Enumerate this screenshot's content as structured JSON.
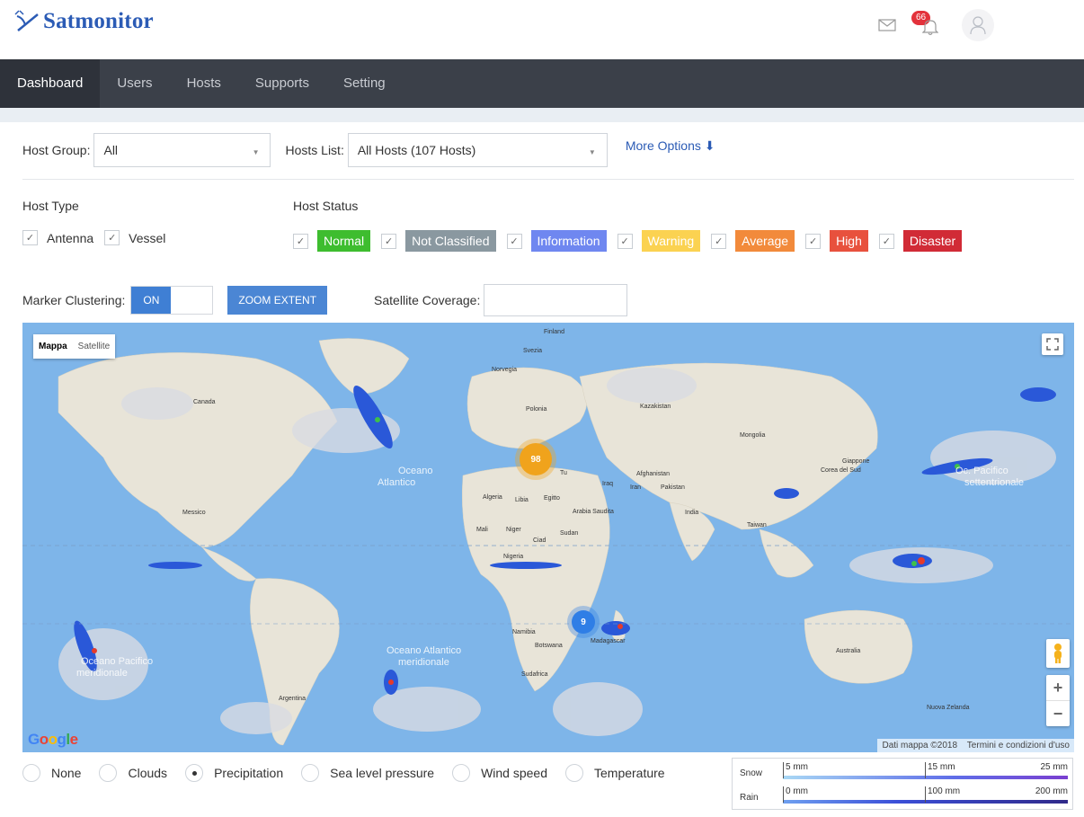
{
  "app": {
    "name": "Satmonitor"
  },
  "header": {
    "notification_count": "66"
  },
  "nav": {
    "items": [
      {
        "label": "Dashboard",
        "active": true
      },
      {
        "label": "Users"
      },
      {
        "label": "Hosts"
      },
      {
        "label": "Supports"
      },
      {
        "label": "Setting"
      }
    ]
  },
  "filters": {
    "host_group_label": "Host Group:",
    "host_group_value": "All",
    "hosts_list_label": "Hosts List:",
    "hosts_list_value": "All Hosts (107 Hosts)",
    "more_options": "More Options ⬇"
  },
  "host_type": {
    "title": "Host Type",
    "options": [
      {
        "label": "Antenna",
        "checked": true
      },
      {
        "label": "Vessel",
        "checked": true
      }
    ]
  },
  "host_status": {
    "title": "Host Status",
    "options": [
      {
        "label": "Normal",
        "color": "#3ebd2f",
        "checked": true
      },
      {
        "label": "Not Classified",
        "color": "#8a98a0",
        "checked": true
      },
      {
        "label": "Information",
        "color": "#6f87f0",
        "checked": true
      },
      {
        "label": "Warning",
        "color": "#fbd251",
        "checked": true
      },
      {
        "label": "Average",
        "color": "#f28a3b",
        "checked": true
      },
      {
        "label": "High",
        "color": "#e8513d",
        "checked": true
      },
      {
        "label": "Disaster",
        "color": "#d12b36",
        "checked": true
      }
    ]
  },
  "controls": {
    "marker_clustering_label": "Marker Clustering:",
    "toggle_on": "ON",
    "zoom_extent": "ZOOM EXTENT",
    "satellite_coverage_label": "Satellite Coverage:"
  },
  "map": {
    "type_map": "Mappa",
    "type_satellite": "Satellite",
    "attribution_data": "Dati mappa ©2018",
    "attribution_terms": "Termini e condizioni d'uso",
    "clusters": [
      {
        "count": "98",
        "color": "#f0a31c"
      },
      {
        "count": "9",
        "color": "#2f7ee6"
      }
    ],
    "labels": {
      "canada": "Canada",
      "messico": "Messico",
      "argentina": "Argentina",
      "finland": "Finland",
      "svezia": "Svezia",
      "norvegia": "Norvegia",
      "polonia": "Polonia",
      "kazakistan": "Kazakistan",
      "mongolia": "Mongolia",
      "algeria": "Algeria",
      "libia": "Libia",
      "egitto": "Egitto",
      "mali": "Mali",
      "niger": "Niger",
      "ciad": "Ciad",
      "sudan": "Sudan",
      "nigeria": "Nigeria",
      "arabia": "Arabia Saudita",
      "iraq": "Iraq",
      "iran": "Iran",
      "afghanistan": "Afghanistan",
      "pakistan": "Pakistan",
      "india": "India",
      "corea": "Corea del Sud",
      "giappone": "Giappone",
      "australia": "Australia",
      "nzelanda": "Nuova Zelanda",
      "namibia": "Namibia",
      "botswana": "Botswana",
      "sudafrica": "Sudafrica",
      "madagascar": "Madagascar",
      "pacifico": "Oceano Pacifico",
      "meridionale": "meridionale",
      "atlantico": "Atlantico",
      "oceano": "Oceano",
      "oc_pac": "Oc. Pacifico",
      "settentrionale": "settentrionale",
      "oceano_atl_s": "Oceano Atlantico",
      "meridionale2": "meridionale",
      "tu": "Tu",
      "taiwan": "Taiwan"
    }
  },
  "layers": {
    "options": [
      {
        "label": "None",
        "selected": false
      },
      {
        "label": "Clouds",
        "selected": false
      },
      {
        "label": "Precipitation",
        "selected": true
      },
      {
        "label": "Sea level pressure",
        "selected": false
      },
      {
        "label": "Wind speed",
        "selected": false
      },
      {
        "label": "Temperature",
        "selected": false
      }
    ]
  },
  "legend": {
    "snow": {
      "name": "Snow",
      "ticks": [
        "5 mm",
        "15 mm",
        "25 mm"
      ]
    },
    "rain": {
      "name": "Rain",
      "ticks": [
        "0 mm",
        "100 mm",
        "200 mm"
      ]
    }
  }
}
